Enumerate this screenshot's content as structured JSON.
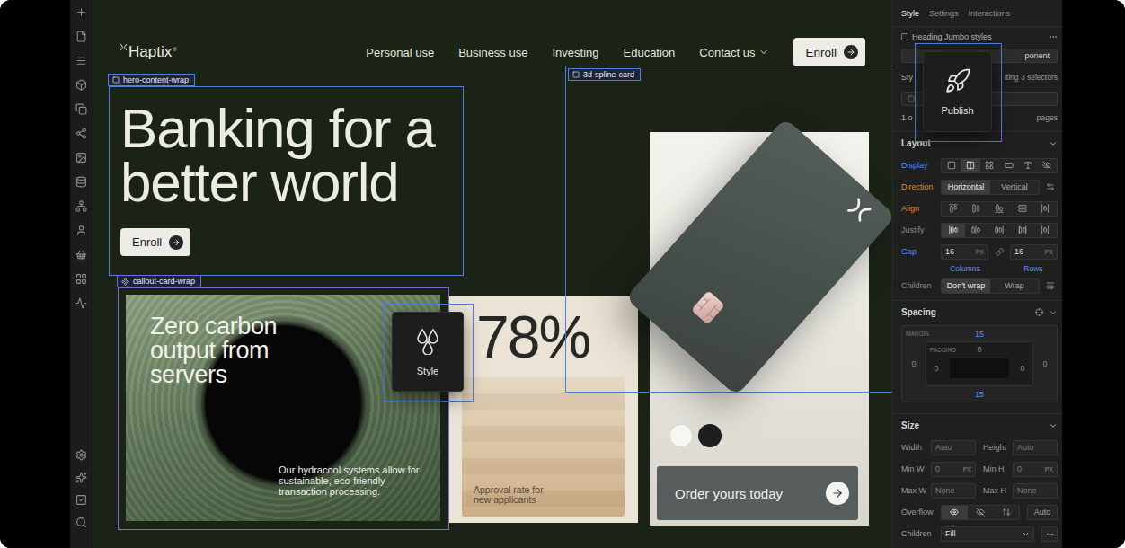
{
  "canvas": {
    "site": {
      "logo": {
        "name": "Haptix",
        "mark": "®"
      },
      "nav": [
        {
          "label": "Personal use",
          "dropdown": false
        },
        {
          "label": "Business use",
          "dropdown": false
        },
        {
          "label": "Investing",
          "dropdown": false
        },
        {
          "label": "Education",
          "dropdown": false
        },
        {
          "label": "Contact us",
          "dropdown": true
        }
      ],
      "nav_button": "Enroll",
      "hero": {
        "headline": "Banking for a better world",
        "button": "Enroll"
      },
      "callout": {
        "title": "Zero carbon output from servers",
        "body": "Our hydracool systems allow for sustainable, eco-friendly transaction processing."
      },
      "stat": {
        "value": "78%",
        "caption": "Approval rate for new applicants"
      },
      "product": {
        "swatches": [
          {
            "color": "#f7f7f3"
          },
          {
            "color": "#1f1f1f"
          }
        ],
        "button": "Order yours today"
      }
    },
    "selections": [
      {
        "label": "hero-content-wrap",
        "kind": "element",
        "color": "#4a7fe0"
      },
      {
        "label": "callout-card-wrap",
        "kind": "component",
        "color": "#7b68d8"
      },
      {
        "label": "3d-spline-card",
        "kind": "element",
        "color": "#4a7fe0"
      }
    ],
    "floating_tags": [
      {
        "label": "Style",
        "kind": "style"
      },
      {
        "label": "Publish",
        "kind": "publish"
      }
    ]
  },
  "style_panel": {
    "tabs": [
      {
        "label": "Style",
        "selected": true
      },
      {
        "label": "Settings",
        "selected": false
      },
      {
        "label": "Interactions",
        "selected": false
      }
    ],
    "heading": {
      "label": "Heading Jumbo styles",
      "checked": false
    },
    "component_button": "ponent",
    "selector": {
      "label": "Sty",
      "info": "iting 3 selectors"
    },
    "usage": {
      "label": "1 o",
      "info": "pages"
    },
    "layout": {
      "title": "Layout",
      "display": {
        "label": "Display",
        "color": "#4d8ff0",
        "options": [
          {
            "kind": "block",
            "selected": false
          },
          {
            "kind": "flex",
            "selected": true
          },
          {
            "kind": "grid",
            "selected": false
          },
          {
            "kind": "inline-block",
            "selected": false
          },
          {
            "kind": "inline",
            "selected": false
          },
          {
            "kind": "none",
            "selected": false
          }
        ]
      },
      "direction": {
        "label": "Direction",
        "color": "#d98a3d",
        "options": [
          {
            "label": "Horizontal",
            "selected": true
          },
          {
            "label": "Vertical",
            "selected": false
          }
        ]
      },
      "align": {
        "label": "Align",
        "color": "#d98a3d",
        "options": [
          {
            "kind": "start",
            "selected": false
          },
          {
            "kind": "center",
            "selected": false
          },
          {
            "kind": "end",
            "selected": false
          },
          {
            "kind": "stretch",
            "selected": false
          },
          {
            "kind": "baseline",
            "selected": false
          }
        ]
      },
      "justify": {
        "label": "Justify",
        "color": "#8a8a8a",
        "options": [
          {
            "kind": "start",
            "selected": true
          },
          {
            "kind": "center",
            "selected": false
          },
          {
            "kind": "end",
            "selected": false
          },
          {
            "kind": "between",
            "selected": false
          },
          {
            "kind": "around",
            "selected": false
          }
        ]
      },
      "gap": {
        "label": "Gap",
        "color": "#4d8ff0",
        "fields": [
          {
            "value": "16",
            "unit": "PX",
            "caption": "Columns"
          },
          {
            "value": "16",
            "unit": "PX",
            "caption": "Rows"
          }
        ]
      },
      "children": {
        "label": "Children",
        "color": "#8a8a8a",
        "options": [
          {
            "label": "Don't wrap",
            "selected": true
          },
          {
            "label": "Wrap",
            "selected": false
          }
        ]
      }
    },
    "spacing": {
      "title": "Spacing",
      "margin": {
        "label": "MARGIN",
        "top": {
          "value": "15",
          "color": "#4d8ff0"
        },
        "right": {
          "value": "0",
          "color": "#8a8a8a"
        },
        "bottom": {
          "value": "15",
          "color": "#4d8ff0"
        },
        "left": {
          "value": "0",
          "color": "#8a8a8a"
        }
      },
      "padding": {
        "label": "PADDING",
        "top": {
          "value": "0",
          "color": "#8a8a8a"
        },
        "right": {
          "value": "0",
          "color": "#8a8a8a"
        },
        "left": {
          "value": "0",
          "color": "#8a8a8a"
        }
      }
    },
    "size": {
      "title": "Size",
      "fields": [
        {
          "label": "Width",
          "value": "Auto",
          "unit": ""
        },
        {
          "label": "Height",
          "value": "Auto",
          "unit": ""
        },
        {
          "label": "Min W",
          "value": "0",
          "unit": "PX"
        },
        {
          "label": "Min H",
          "value": "0",
          "unit": "PX"
        },
        {
          "label": "Max W",
          "value": "None",
          "unit": ""
        },
        {
          "label": "Max H",
          "value": "None",
          "unit": ""
        }
      ],
      "overflow": {
        "label": "Overflow",
        "options": [
          {
            "kind": "visible",
            "selected": true
          },
          {
            "kind": "hidden",
            "selected": false
          },
          {
            "kind": "scroll",
            "selected": false
          }
        ],
        "auto": "Auto"
      },
      "children": {
        "label": "Children",
        "value": "Fill"
      }
    }
  }
}
